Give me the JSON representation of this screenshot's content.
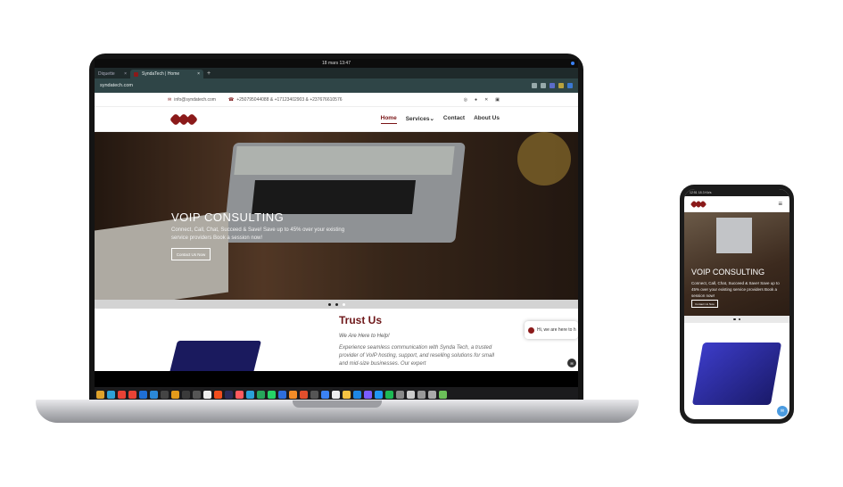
{
  "os": {
    "clock": "18 mars  13:47"
  },
  "browser": {
    "tabs": [
      {
        "label": "Diquette",
        "active": false
      },
      {
        "label": "SyndaTech | Home",
        "active": true
      }
    ],
    "new_tab": "+",
    "url": "syndatech.com"
  },
  "site": {
    "topbar": {
      "email": "info@syndatech.com",
      "phones": "+250795044088 & +17123402903 & +237676610576",
      "social": [
        "whatsapp-icon",
        "facebook-icon",
        "x-icon",
        "linkedin-icon"
      ]
    },
    "nav": {
      "items": [
        "Home",
        "Services",
        "Contact",
        "About Us"
      ]
    },
    "hero": {
      "title": "VOIP CONSULTING",
      "subtitle": "Connect, Call, Chat, Succeed & Save! Save up to 45% over your existing service providers Book a session now!",
      "button": "Contact Us Now"
    },
    "trust": {
      "title": "Trust Us",
      "tagline": "We Are Here to Help!",
      "text": "Experience seamless communication with Synda Tech, a trusted provider of VoIP hosting, support, and reselling solutions for small and mid-size businesses. Our expert"
    },
    "chat": {
      "bubble": "Hi, we are here to h"
    }
  },
  "phone": {
    "status": "12:51  18.3 Kb/s",
    "hero": {
      "title": "VOIP CONSULTING",
      "subtitle": "Connect, Call, Chat, Succeed & Save! Save up to 45% over your existing service providers Book a session now!",
      "button": "Contact Us Now"
    }
  },
  "colors": {
    "brand": "#7a1416",
    "browser_chrome": "#2f4547"
  }
}
